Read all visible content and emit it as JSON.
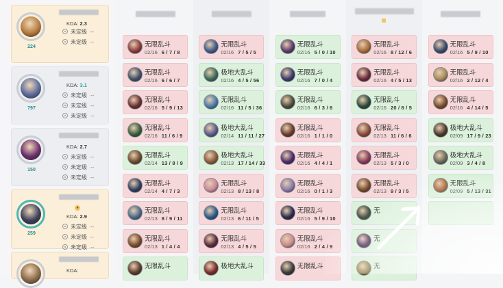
{
  "players": [
    {
      "kda_label": "KDA:",
      "kda": "2.3",
      "kda_teal": false,
      "level": "224",
      "ranks": [
        [
          "未定级",
          "--"
        ],
        [
          "未定级",
          "--"
        ]
      ],
      "style": "gold",
      "ring": "gray",
      "avatar_color": "#b57a3e",
      "badge": false
    },
    {
      "kda_label": "KDA:",
      "kda": "3.1",
      "kda_teal": true,
      "level": "797",
      "ranks": [
        [
          "未定级",
          "--"
        ],
        [
          "未定级",
          "--"
        ],
        [
          "未定级",
          "--"
        ]
      ],
      "style": "gray",
      "ring": "gray",
      "avatar_color": "#5b6b9c",
      "badge": false
    },
    {
      "kda_label": "KDA:",
      "kda": "2.7",
      "kda_teal": false,
      "level": "150",
      "ranks": [
        [
          "未定级",
          "--"
        ],
        [
          "未定级",
          "--"
        ],
        [
          "未定级",
          "--"
        ]
      ],
      "style": "gray",
      "ring": "gray",
      "avatar_color": "#6b2f6e",
      "badge": false
    },
    {
      "kda_label": "KDA:",
      "kda": "2.9",
      "kda_teal": false,
      "level": "259",
      "ranks": [
        [
          "未定级",
          "--"
        ],
        [
          "未定级",
          "--"
        ],
        [
          "未定级",
          "--"
        ]
      ],
      "style": "gold",
      "ring": "teal",
      "avatar_color": "#3a3f5c",
      "badge": true
    },
    {
      "kda_label": "KDA:",
      "kda": "",
      "kda_teal": false,
      "level": "",
      "ranks": [],
      "style": "gold",
      "ring": "gray",
      "avatar_color": "#8a6a4a",
      "badge": false
    }
  ],
  "columns": [
    {
      "cells": [
        {
          "mode": "无限乱斗",
          "date": "02/16",
          "kda": "6 / 7 / 8",
          "result": "red",
          "color": "#8a3b3b"
        },
        {
          "mode": "无限乱斗",
          "date": "02/16",
          "kda": "6 / 6 / 7",
          "result": "red",
          "color": "#3f4f6a"
        },
        {
          "mode": "无限乱斗",
          "date": "02/16",
          "kda": "5 / 9 / 13",
          "result": "red",
          "color": "#6a2f2f"
        },
        {
          "mode": "无限乱斗",
          "date": "02/16",
          "kda": "11 / 6 / 9",
          "result": "red",
          "color": "#355e3b"
        },
        {
          "mode": "无限乱斗",
          "date": "02/14",
          "kda": "13 / 8 / 9",
          "result": "green",
          "color": "#6b4a2a"
        },
        {
          "mode": "无限乱斗",
          "date": "02/14",
          "kda": "4 / 7 / 3",
          "result": "red",
          "color": "#2f3e5e"
        },
        {
          "mode": "无限乱斗",
          "date": "02/13",
          "kda": "8 / 9 / 11",
          "result": "red",
          "color": "#4a6a8a"
        },
        {
          "mode": "无限乱斗",
          "date": "02/13",
          "kda": "1 / 4 / 4",
          "result": "red",
          "color": "#7a4a2a"
        },
        {
          "mode": "无限乱斗",
          "date": "",
          "kda": "",
          "result": "green",
          "color": "#5a3a2a"
        }
      ]
    },
    {
      "cells": [
        {
          "mode": "无限乱斗",
          "date": "02/16",
          "kda": "7 / 5 / 5",
          "result": "red",
          "color": "#3f5a8a"
        },
        {
          "mode": "极地大乱斗",
          "date": "02/16",
          "kda": "4 / 5 / 56",
          "result": "green",
          "color": "#3b6a5a"
        },
        {
          "mode": "无限乱斗",
          "date": "02/16",
          "kda": "11 / 5 / 36",
          "result": "green",
          "color": "#4a7aa8"
        },
        {
          "mode": "极地大乱斗",
          "date": "02/14",
          "kda": "11 / 11 / 27",
          "result": "green",
          "color": "#5a5a8a"
        },
        {
          "mode": "极地大乱斗",
          "date": "02/13",
          "kda": "17 / 14 / 33",
          "result": "green",
          "color": "#8a5a3a"
        },
        {
          "mode": "无限乱斗",
          "date": "02/13",
          "kda": "8 / 13 / 8",
          "result": "red",
          "color": "#c88a9a"
        },
        {
          "mode": "无限乱斗",
          "date": "02/13",
          "kda": "6 / 11 / 5",
          "result": "red",
          "color": "#2a5a8a"
        },
        {
          "mode": "无限乱斗",
          "date": "02/13",
          "kda": "4 / 5 / 5",
          "result": "red",
          "color": "#5a2a3a"
        },
        {
          "mode": "极地大乱斗",
          "date": "",
          "kda": "",
          "result": "green",
          "color": "#7a2a2a"
        }
      ]
    },
    {
      "cells": [
        {
          "mode": "无限乱斗",
          "date": "02/16",
          "kda": "5 / 0 / 10",
          "result": "green",
          "color": "#5a3a6a"
        },
        {
          "mode": "无限乱斗",
          "date": "02/16",
          "kda": "7 / 0 / 4",
          "result": "green",
          "color": "#3a3a6a"
        },
        {
          "mode": "无限乱斗",
          "date": "02/16",
          "kda": "6 / 3 / 6",
          "result": "green",
          "color": "#4a4a3a"
        },
        {
          "mode": "无限乱斗",
          "date": "02/16",
          "kda": "1 / 1 / 0",
          "result": "red",
          "color": "#6a3a2a"
        },
        {
          "mode": "无限乱斗",
          "date": "02/16",
          "kda": "4 / 4 / 1",
          "result": "red",
          "color": "#4a2a6a"
        },
        {
          "mode": "无限乱斗",
          "date": "02/16",
          "kda": "0 / 1 / 3",
          "result": "red",
          "color": "#8a7aa8"
        },
        {
          "mode": "无限乱斗",
          "date": "02/16",
          "kda": "5 / 9 / 10",
          "result": "red",
          "color": "#2a2a4a"
        },
        {
          "mode": "无限乱斗",
          "date": "02/16",
          "kda": "2 / 4 / 9",
          "result": "red",
          "color": "#c88a8a"
        },
        {
          "mode": "无限乱斗",
          "date": "",
          "kda": "",
          "result": "red",
          "color": "#3a3a3a"
        }
      ]
    },
    {
      "cells": [
        {
          "mode": "无限乱斗",
          "date": "02/16",
          "kda": "8 / 12 / 6",
          "result": "red",
          "color": "#a86a3a"
        },
        {
          "mode": "无限乱斗",
          "date": "02/16",
          "kda": "4 / 5 / 13",
          "result": "red",
          "color": "#6a2a3a"
        },
        {
          "mode": "无限乱斗",
          "date": "02/16",
          "kda": "20 / 8 / 5",
          "result": "green",
          "color": "#2a4a3a"
        },
        {
          "mode": "无限乱斗",
          "date": "02/13",
          "kda": "11 / 6 / 6",
          "result": "red",
          "color": "#8a4a3a"
        },
        {
          "mode": "无限乱斗",
          "date": "02/13",
          "kda": "5 / 3 / 0",
          "result": "red",
          "color": "#8a3a5a"
        },
        {
          "mode": "无限乱斗",
          "date": "02/13",
          "kda": "9 / 3 / 5",
          "result": "red",
          "color": "#7a4a2a"
        },
        {
          "mode": "无",
          "date": "",
          "kda": "",
          "result": "green",
          "color": "#3a4a3a"
        },
        {
          "mode": "无",
          "date": "",
          "kda": "",
          "result": "green",
          "color": "#4a2a5a"
        },
        {
          "mode": "无",
          "date": "",
          "kda": "",
          "result": "green",
          "color": "#8a7a3a"
        }
      ]
    },
    {
      "cells": [
        {
          "mode": "无限乱斗",
          "date": "02/16",
          "kda": "5 / 9 / 10",
          "result": "red",
          "color": "#3a4a6a"
        },
        {
          "mode": "无限乱斗",
          "date": "02/16",
          "kda": "2 / 12 / 4",
          "result": "red",
          "color": "#a88a5a"
        },
        {
          "mode": "无限乱斗",
          "date": "02/16",
          "kda": "4 / 14 / 5",
          "result": "red",
          "color": "#7a4a2a"
        },
        {
          "mode": "极地大乱斗",
          "date": "02/09",
          "kda": "17 / 9 / 23",
          "result": "green",
          "color": "#4a3a2a"
        },
        {
          "mode": "极地大乱斗",
          "date": "02/09",
          "kda": "3 / 4 / 8",
          "result": "green",
          "color": "#6a6a5a"
        },
        {
          "mode": "无限乱斗",
          "date": "02/09",
          "kda": "5 / 13 / 31",
          "result": "green",
          "color": "#a86a3a"
        },
        {
          "mode": "",
          "date": "",
          "kda": "",
          "result": "green",
          "color": ""
        }
      ]
    }
  ]
}
